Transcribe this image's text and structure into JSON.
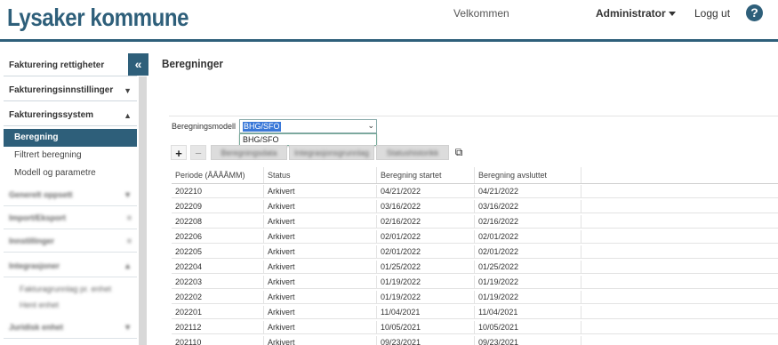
{
  "header": {
    "logo": "Lysaker kommune",
    "welcome": "Velkommen",
    "user_menu": "Administrator",
    "logout": "Logg ut",
    "help": "?"
  },
  "sidebar": {
    "collapse": "«",
    "sections": [
      {
        "label": "Fakturering rettigheter"
      },
      {
        "label": "Faktureringsinnstillinger"
      },
      {
        "label": "Faktureringssystem"
      }
    ],
    "items": [
      {
        "label": "Beregning",
        "active": true
      },
      {
        "label": "Filtrert beregning"
      },
      {
        "label": "Modell og parametre"
      }
    ],
    "blurred_sections": [
      {
        "label": "Generelt oppsett"
      },
      {
        "label": "Import/Eksport"
      },
      {
        "label": "Innstillinger"
      },
      {
        "label": "Integrasjoner"
      },
      {
        "label": "Juridisk enhet"
      }
    ],
    "blurred_items": [
      {
        "label": "Fakturagrunnlag pr. enhet"
      },
      {
        "label": "Hent enhet"
      }
    ]
  },
  "main": {
    "title": "Beregninger",
    "model_label": "Beregningsmodell",
    "model_value": "BHG/SFO",
    "dropdown_options": [
      "BHG/SFO"
    ],
    "toolbar": {
      "add": "+",
      "remove": "−",
      "btn1": "Beregningsdata",
      "btn2": "Integrasjonsgrunnlag",
      "btn3": "Statushistorikk",
      "export": "⧉"
    },
    "table": {
      "columns": [
        "Periode (ÅÅÅÅMM)",
        "Status",
        "Beregning startet",
        "Beregning avsluttet"
      ],
      "rows": [
        [
          "202210",
          "Arkivert",
          "04/21/2022",
          "04/21/2022"
        ],
        [
          "202209",
          "Arkivert",
          "03/16/2022",
          "03/16/2022"
        ],
        [
          "202208",
          "Arkivert",
          "02/16/2022",
          "02/16/2022"
        ],
        [
          "202206",
          "Arkivert",
          "02/01/2022",
          "02/01/2022"
        ],
        [
          "202205",
          "Arkivert",
          "02/01/2022",
          "02/01/2022"
        ],
        [
          "202204",
          "Arkivert",
          "01/25/2022",
          "01/25/2022"
        ],
        [
          "202203",
          "Arkivert",
          "01/19/2022",
          "01/19/2022"
        ],
        [
          "202202",
          "Arkivert",
          "01/19/2022",
          "01/19/2022"
        ],
        [
          "202201",
          "Arkivert",
          "11/04/2021",
          "11/04/2021"
        ],
        [
          "202112",
          "Arkivert",
          "10/05/2021",
          "10/05/2021"
        ],
        [
          "202110",
          "Arkivert",
          "09/23/2021",
          "09/23/2021"
        ]
      ]
    }
  },
  "colors": {
    "brand": "#2e5f7a",
    "selection": "#3a78d8"
  }
}
